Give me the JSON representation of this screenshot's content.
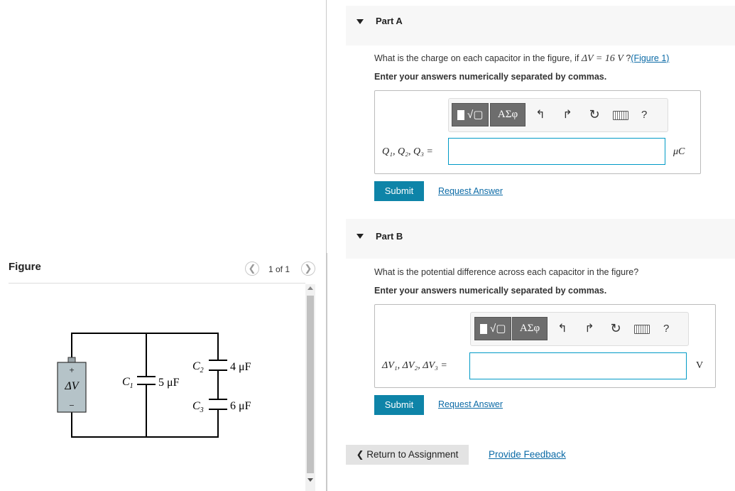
{
  "figure": {
    "title": "Figure",
    "pager": "1 of 1",
    "circuit": {
      "source_plus": "+",
      "source_label": "ΔV",
      "source_minus": "−",
      "c1_name": "C",
      "c1_sub": "1",
      "c1_value": "5 μF",
      "c2_name": "C",
      "c2_sub": "2",
      "c2_value": "4 μF",
      "c3_name": "C",
      "c3_sub": "3",
      "c3_value": "6 μF"
    }
  },
  "partA": {
    "title": "Part A",
    "question_prefix": "What is the charge on each capacitor in the figure, if ",
    "question_math": "ΔV = 16 V",
    "question_suffix": " ?",
    "figure_link": "(Figure 1)",
    "instruction": "Enter your answers numerically separated by commas.",
    "answer_label": "Q₁, Q₂, Q₃ =",
    "unit": "μC",
    "input_value": "",
    "submit": "Submit",
    "request_answer": "Request Answer"
  },
  "partB": {
    "title": "Part B",
    "question": "What is the potential difference across each capacitor in the figure?",
    "instruction": "Enter your answers numerically separated by commas.",
    "answer_label": "ΔV₁, ΔV₂, ΔV₃ =",
    "unit": "V",
    "input_value": "",
    "submit": "Submit",
    "request_answer": "Request Answer"
  },
  "toolbar": {
    "templates_label": "√▢",
    "symbols_label": "ΑΣφ",
    "undo_icon": "undo-icon",
    "redo_icon": "redo-icon",
    "reset_icon": "reset-icon",
    "keyboard_icon": "keyboard-icon",
    "help_label": "?"
  },
  "footer": {
    "return_label": "Return to Assignment",
    "feedback_label": "Provide Feedback"
  },
  "colors": {
    "submit": "#0e84a8",
    "link": "#0b6aa6",
    "input_border": "#009ac6"
  }
}
